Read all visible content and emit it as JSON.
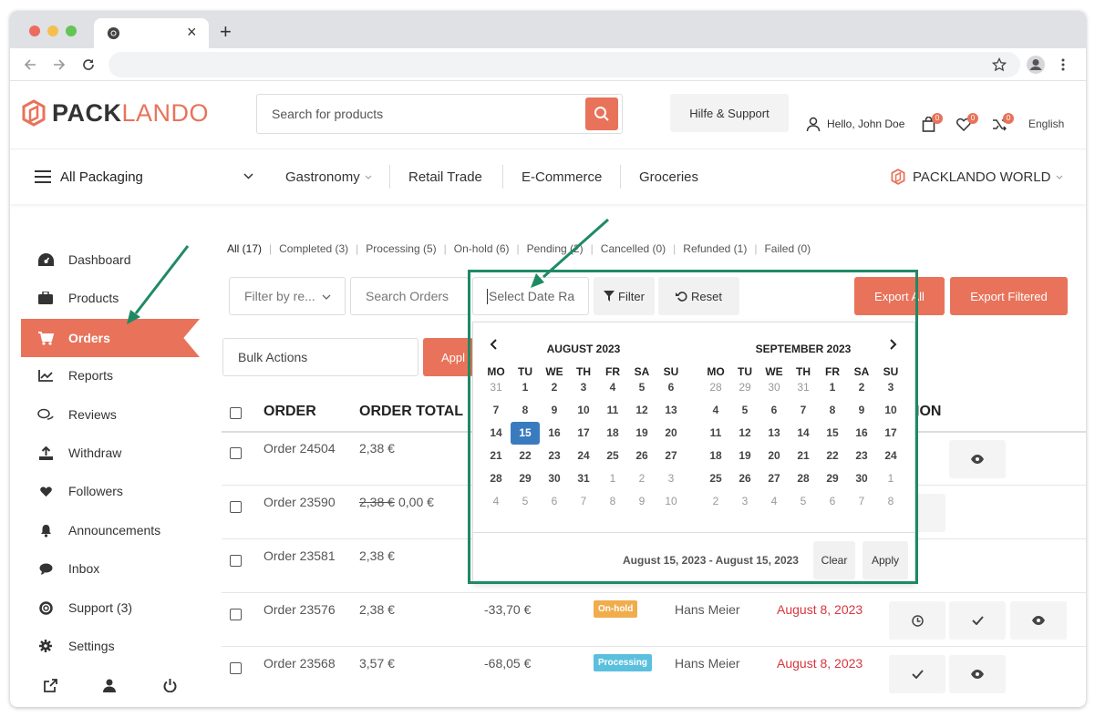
{
  "browser": {
    "tab_close": "×",
    "tab_new": "+"
  },
  "header": {
    "logo_pack": "PACK",
    "logo_lando": "LANDO",
    "search_placeholder": "Search for products",
    "support_label": "Hilfe & Support",
    "greeting": "Hello, John Doe",
    "cart_count": "0",
    "wishlist_count": "0",
    "compare_count": "0",
    "language": "English"
  },
  "nav": {
    "all_packaging": "All Packaging",
    "items": [
      "Gastronomy",
      "Retail Trade",
      "E-Commerce",
      "Groceries"
    ],
    "world": "PACKLANDO WORLD"
  },
  "sidebar": {
    "items": [
      "Dashboard",
      "Products",
      "Orders",
      "Reports",
      "Reviews",
      "Withdraw",
      "Followers",
      "Announcements",
      "Inbox",
      "Support (3)",
      "Settings"
    ],
    "active": "Orders"
  },
  "status_tabs": [
    "All (17)",
    "Completed (3)",
    "Processing (5)",
    "On-hold (6)",
    "Pending (2)",
    "Cancelled (0)",
    "Refunded (1)",
    "Failed (0)"
  ],
  "filters": {
    "filter_by": "Filter by re...",
    "search_orders": "Search Orders",
    "date_placeholder": "Select Date Ra",
    "filter_btn": "Filter",
    "reset_btn": "Reset",
    "export_all": "Export All",
    "export_filtered": "Export Filtered",
    "bulk_actions": "Bulk Actions",
    "apply": "Appl"
  },
  "table": {
    "headers": [
      "ORDER",
      "ORDER TOTAL",
      "ION"
    ],
    "rows": [
      {
        "order": "Order 24504",
        "total": "2,38 €"
      },
      {
        "order": "Order 23590",
        "total_old": "2,38 €",
        "total": "0,00 €"
      },
      {
        "order": "Order 23581",
        "total": "2,38 €"
      },
      {
        "order": "Order 23576",
        "total": "2,38 €",
        "earning": "-33,70 €",
        "status": "On-hold",
        "customer": "Hans Meier",
        "date": "August 8, 2023"
      },
      {
        "order": "Order 23568",
        "total": "3,57 €",
        "earning": "-68,05 €",
        "status": "Processing",
        "customer": "Hans Meier",
        "date": "August 8, 2023"
      }
    ]
  },
  "datepicker": {
    "left_month": "AUGUST 2023",
    "right_month": "SEPTEMBER 2023",
    "weekdays": [
      "MO",
      "TU",
      "WE",
      "TH",
      "FR",
      "SA",
      "SU"
    ],
    "left_days": [
      [
        "31",
        "1",
        "2",
        "3",
        "4",
        "5",
        "6"
      ],
      [
        "7",
        "8",
        "9",
        "10",
        "11",
        "12",
        "13"
      ],
      [
        "14",
        "15",
        "16",
        "17",
        "18",
        "19",
        "20"
      ],
      [
        "21",
        "22",
        "23",
        "24",
        "25",
        "26",
        "27"
      ],
      [
        "28",
        "29",
        "30",
        "31",
        "1",
        "2",
        "3"
      ],
      [
        "4",
        "5",
        "6",
        "7",
        "8",
        "9",
        "10"
      ]
    ],
    "right_days": [
      [
        "28",
        "29",
        "30",
        "31",
        "1",
        "2",
        "3"
      ],
      [
        "4",
        "5",
        "6",
        "7",
        "8",
        "9",
        "10"
      ],
      [
        "11",
        "12",
        "13",
        "14",
        "15",
        "16",
        "17"
      ],
      [
        "18",
        "19",
        "20",
        "21",
        "22",
        "23",
        "24"
      ],
      [
        "25",
        "26",
        "27",
        "28",
        "29",
        "30",
        "1"
      ],
      [
        "2",
        "3",
        "4",
        "5",
        "6",
        "7",
        "8"
      ]
    ],
    "selected_day": "15",
    "range_label": "August 15, 2023 - August 15, 2023",
    "clear": "Clear",
    "apply": "Apply"
  },
  "colors": {
    "accent": "#e8735a",
    "highlight": "#1e8a63",
    "selected": "#3a7bbf",
    "onhold": "#f0ad4e",
    "processing": "#5bc0de",
    "date_red": "#d9363e"
  }
}
